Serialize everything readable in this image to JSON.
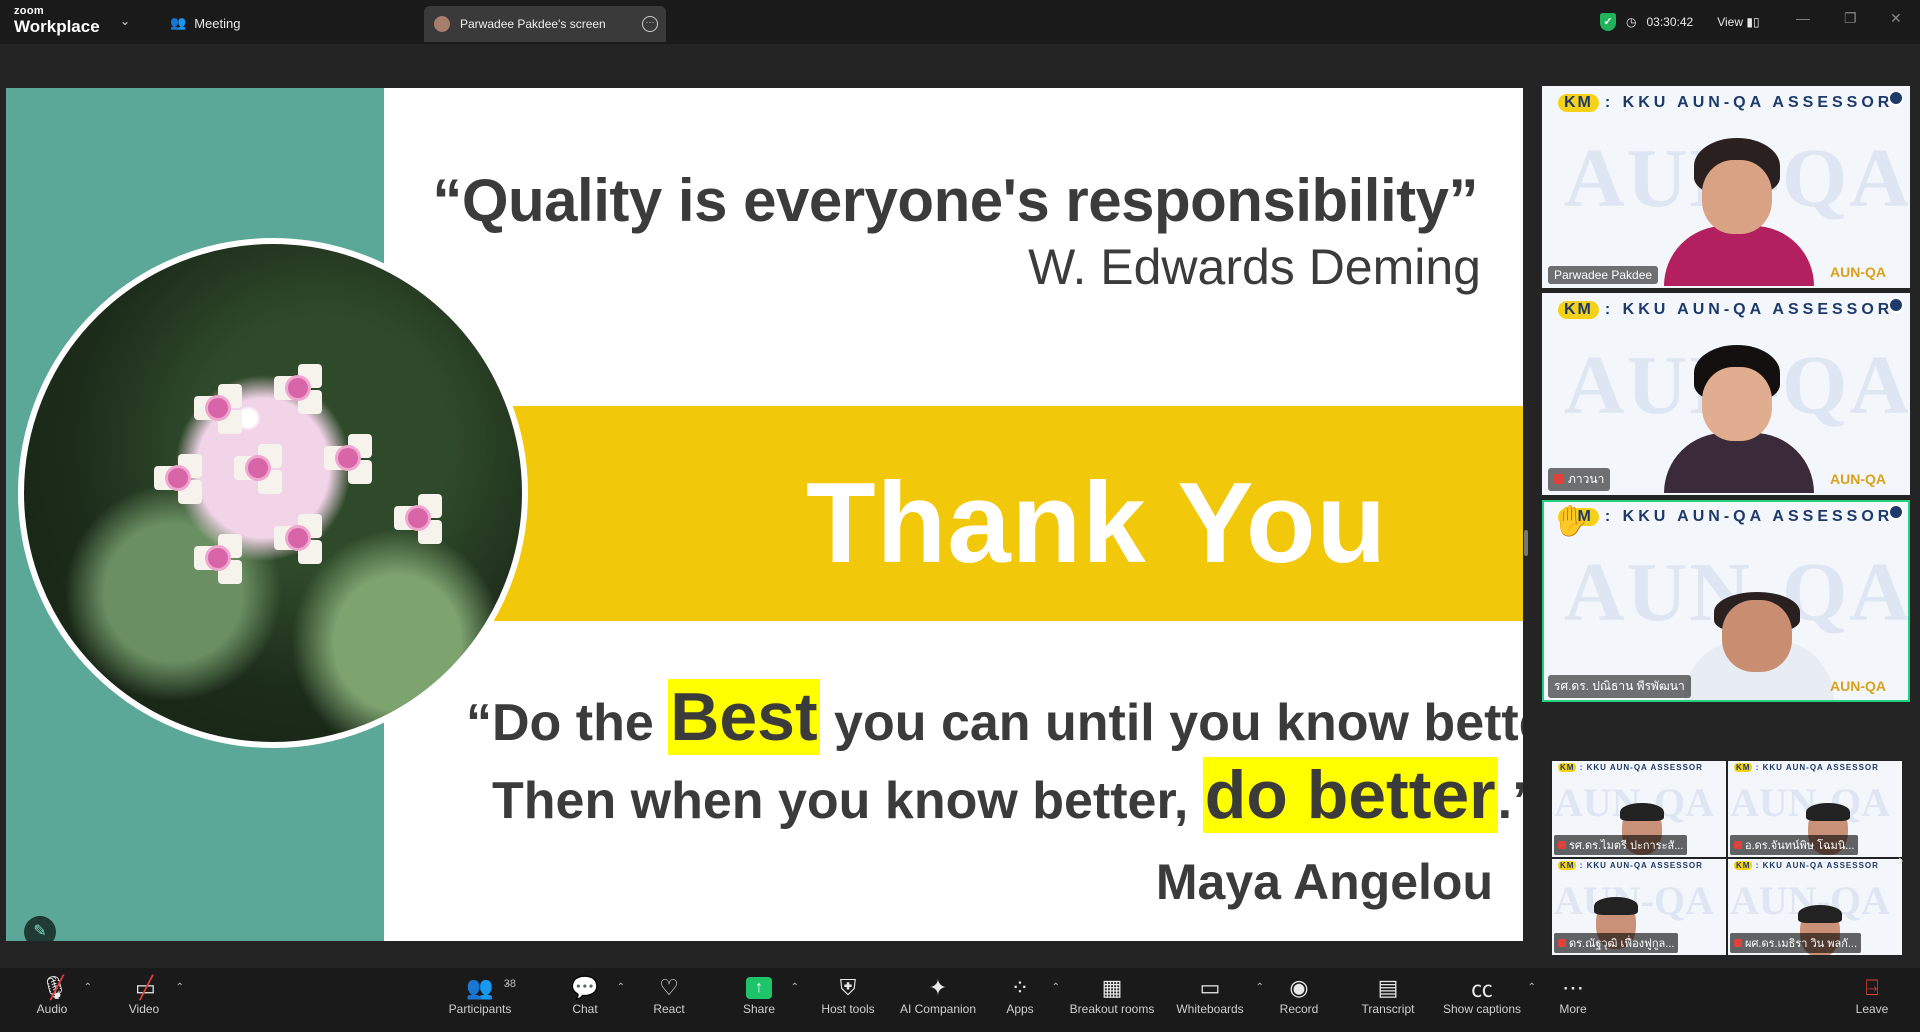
{
  "topbar": {
    "brand_line1": "zoom",
    "brand_line2": "Workplace",
    "meeting_label": "Meeting",
    "screen_tab_label": "Parwadee Pakdee's screen",
    "timer": "03:30:42",
    "view_label": "View"
  },
  "slide": {
    "quote1": "“Quality is everyone's responsibility”",
    "author1": "W. Edwards Deming",
    "thanks": "Thank You",
    "line2_pre": "“Do the ",
    "line2_hl": "Best",
    "line2_post": " you can until you know better.",
    "line3_pre": "Then when you know better, ",
    "line3_hl": "do better",
    "line3_post": ".”",
    "author2": "Maya Angelou"
  },
  "gallery": {
    "header_km": "KM",
    "header_text": ": KKU AUN-QA ASSESSOR",
    "watermark": "AUN-QA",
    "aun_tag": "AUN-QA",
    "tiles": [
      {
        "name": "Parwadee Pakdee"
      },
      {
        "name": "ภาวนา"
      },
      {
        "name": "รศ.ดร. ปณิธาน พีรพัฒนา"
      }
    ],
    "mini": [
      {
        "name": "รศ.ดร.ไมตรี ปะการะสั..."
      },
      {
        "name": "อ.ดร.จันทน์พิษ โฉมนิ..."
      },
      {
        "name": "ดร.ณัฐวุฒิ เฟื่องฟูกูล..."
      },
      {
        "name": "ผศ.ดร.เมธิรา วิน พลกั..."
      }
    ]
  },
  "toolbar": {
    "audio": "Audio",
    "video": "Video",
    "participants": "Participants",
    "participants_count": "38",
    "chat": "Chat",
    "react": "React",
    "share": "Share",
    "host_tools": "Host tools",
    "ai_companion": "AI Companion",
    "apps": "Apps",
    "breakout": "Breakout rooms",
    "whiteboards": "Whiteboards",
    "record": "Record",
    "transcript": "Transcript",
    "captions": "Show captions",
    "more": "More",
    "leave": "Leave"
  },
  "colors": {
    "teal": "#5ba898",
    "yellow_band": "#f2c80a",
    "highlight": "#ffff00",
    "active_tile": "#20d17f",
    "share_green": "#1ec46a",
    "muted_red": "#e0413b"
  }
}
